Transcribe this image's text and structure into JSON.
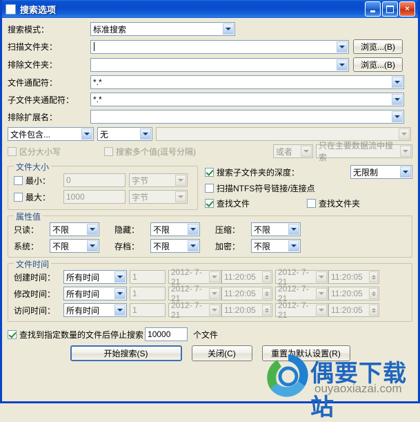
{
  "window": {
    "title": "搜索选项",
    "minimize_label": "最小化",
    "maximize_label": "最大化",
    "close_label": "×",
    "accent_color": "#0a4ccb",
    "background_color": "#ece9d8"
  },
  "form": {
    "search_mode": {
      "label": "搜索模式：",
      "value": "标准搜索"
    },
    "scan_folder": {
      "label": "扫描文件夹：",
      "value": "",
      "browse": "浏览...(B)"
    },
    "exclude_folder": {
      "label": "排除文件夹：",
      "value": "",
      "browse": "浏览...(B)"
    },
    "file_wildcard": {
      "label": "文件通配符：",
      "value": "*.*"
    },
    "subfolder_wildcard": {
      "label": "子文件夹通配符：",
      "value": "*.*"
    },
    "exclude_ext": {
      "label": "排除扩展名：",
      "value": ""
    },
    "contains": {
      "mode": "文件包含...",
      "type": "无",
      "value": ""
    },
    "case_sensitive": {
      "label": "区分大小写",
      "checked": false
    },
    "multi_value": {
      "label": "搜索多个值(逗号分隔)",
      "checked": false
    },
    "logic": "或者",
    "stream": "只在主要数据流中搜索"
  },
  "file_size": {
    "legend": "文件大小",
    "min": {
      "label": "最小：",
      "checked": false,
      "value": "0",
      "unit": "字节"
    },
    "max": {
      "label": "最大：",
      "checked": false,
      "value": "1000",
      "unit": "字节"
    }
  },
  "depth_options": {
    "depth": {
      "label": "搜索子文件夹的深度：",
      "checked": true,
      "value": "无限制"
    },
    "ntfs": {
      "label": "扫描NTFS符号链接/连接点",
      "checked": false
    },
    "find_files": {
      "label": "查找文件",
      "checked": true
    },
    "find_folders": {
      "label": "查找文件夹",
      "checked": false
    }
  },
  "attributes": {
    "legend": "属性值",
    "items": [
      {
        "label": "只读：",
        "value": "不限"
      },
      {
        "label": "隐藏：",
        "value": "不限"
      },
      {
        "label": "压缩：",
        "value": "不限"
      },
      {
        "label": "系统：",
        "value": "不限"
      },
      {
        "label": "存档：",
        "value": "不限"
      },
      {
        "label": "加密：",
        "value": "不限"
      }
    ]
  },
  "file_time": {
    "legend": "文件时间",
    "rows": [
      {
        "label": "创建时间：",
        "mode": "所有时间",
        "count": "1",
        "date1": "2012- 7-21",
        "time1": "11:20:05",
        "date2": "2012- 7-21",
        "time2": "11:20:05"
      },
      {
        "label": "修改时间：",
        "mode": "所有时间",
        "count": "1",
        "date1": "2012- 7-21",
        "time1": "11:20:05",
        "date2": "2012- 7-21",
        "time2": "11:20:05"
      },
      {
        "label": "访问时间：",
        "mode": "所有时间",
        "count": "1",
        "date1": "2012- 7-21",
        "time1": "11:20:05",
        "date2": "2012- 7-21",
        "time2": "11:20:05"
      }
    ]
  },
  "limit": {
    "label": "查找到指定数量的文件后停止搜索",
    "checked": true,
    "value": "10000",
    "suffix": "个文件"
  },
  "buttons": {
    "start": "开始搜索(S)",
    "close": "关闭(C)",
    "reset": "重置为默认设置(R)"
  },
  "watermark": {
    "text": "偶要下载站",
    "url": "ouyaoxiazai.com"
  }
}
